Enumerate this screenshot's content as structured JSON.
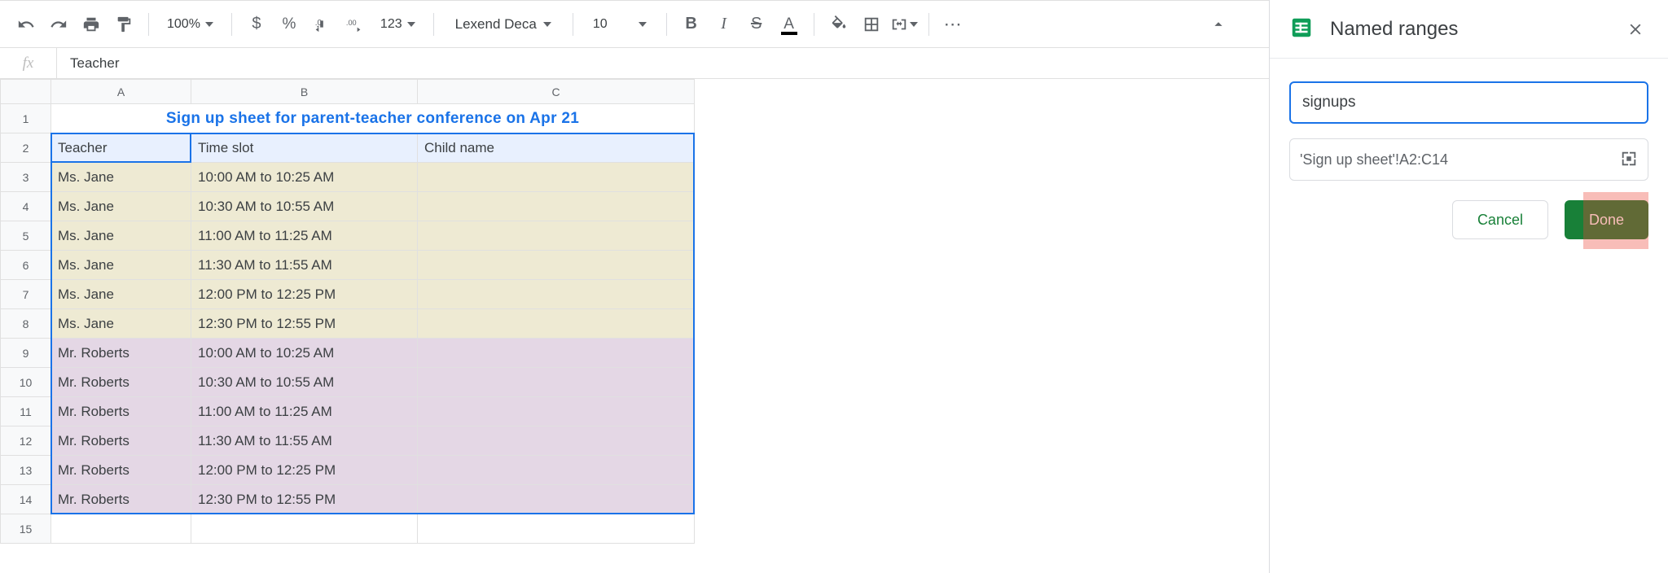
{
  "toolbar": {
    "zoom": "100%",
    "font": "Lexend Deca",
    "font_size": "10",
    "format_number": "123"
  },
  "formula_bar": {
    "value": "Teacher"
  },
  "columns": [
    "A",
    "B",
    "C"
  ],
  "rows_visible": 15,
  "sheet": {
    "title": "Sign up sheet for parent-teacher conference on Apr 21",
    "headers": {
      "a": "Teacher",
      "b": "Time slot",
      "c": "Child name"
    },
    "data": [
      {
        "teacher": "Ms. Jane",
        "slot": "10:00 AM to 10:25 AM",
        "child": "",
        "cls": "jane"
      },
      {
        "teacher": "Ms. Jane",
        "slot": "10:30 AM to 10:55 AM",
        "child": "",
        "cls": "jane"
      },
      {
        "teacher": "Ms. Jane",
        "slot": "11:00 AM to 11:25 AM",
        "child": "",
        "cls": "jane"
      },
      {
        "teacher": "Ms. Jane",
        "slot": "11:30 AM to 11:55 AM",
        "child": "",
        "cls": "jane"
      },
      {
        "teacher": "Ms. Jane",
        "slot": "12:00 PM to 12:25 PM",
        "child": "",
        "cls": "jane"
      },
      {
        "teacher": "Ms. Jane",
        "slot": "12:30 PM to 12:55 PM",
        "child": "",
        "cls": "jane"
      },
      {
        "teacher": "Mr. Roberts",
        "slot": "10:00 AM to 10:25 AM",
        "child": "",
        "cls": "roberts"
      },
      {
        "teacher": "Mr. Roberts",
        "slot": "10:30 AM to 10:55 AM",
        "child": "",
        "cls": "roberts"
      },
      {
        "teacher": "Mr. Roberts",
        "slot": "11:00 AM to 11:25 AM",
        "child": "",
        "cls": "roberts"
      },
      {
        "teacher": "Mr. Roberts",
        "slot": "11:30 AM to 11:55 AM",
        "child": "",
        "cls": "roberts"
      },
      {
        "teacher": "Mr. Roberts",
        "slot": "12:00 PM to 12:25 PM",
        "child": "",
        "cls": "roberts"
      },
      {
        "teacher": "Mr. Roberts",
        "slot": "12:30 PM to 12:55 PM",
        "child": "",
        "cls": "roberts"
      }
    ]
  },
  "selection": {
    "range": "A2:C14",
    "active": "A2"
  },
  "sidebar": {
    "title": "Named ranges",
    "name_value": "signups",
    "range_text": "'Sign up sheet'!A2:C14",
    "cancel": "Cancel",
    "done": "Done"
  }
}
